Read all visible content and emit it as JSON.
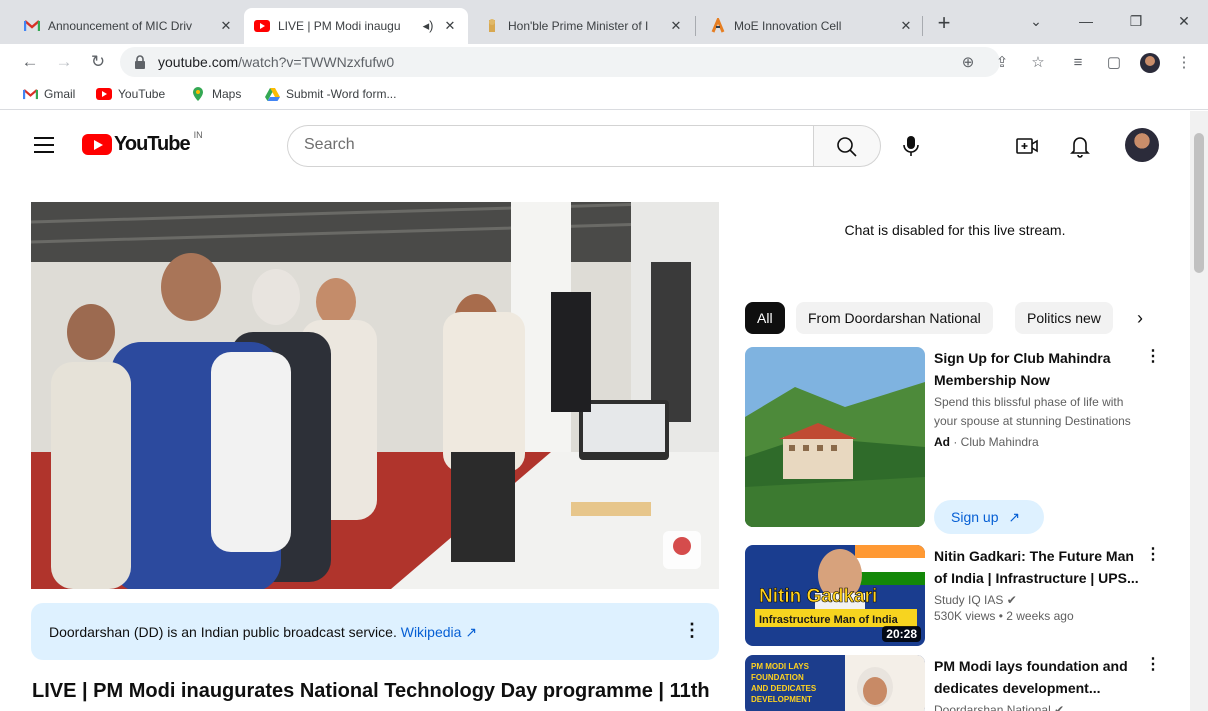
{
  "browser": {
    "tabs": [
      {
        "title": "Announcement of MIC Driv",
        "active": false,
        "favicon": "gmail-icon"
      },
      {
        "title": "LIVE | PM Modi inaugu",
        "active": true,
        "favicon": "youtube-icon",
        "muted": true
      },
      {
        "title": "Hon'ble Prime Minister of I",
        "active": false,
        "favicon": "emblem-icon"
      },
      {
        "title": "MoE Innovation Cell",
        "active": false,
        "favicon": "moe-icon"
      }
    ],
    "url": {
      "host": "youtube.com",
      "path": "/watch?v=TWWNzxfufw0"
    },
    "bookmarks": [
      {
        "label": "Gmail",
        "icon": "gmail-icon"
      },
      {
        "label": "YouTube",
        "icon": "youtube-icon"
      },
      {
        "label": "Maps",
        "icon": "maps-icon"
      },
      {
        "label": "Submit -Word form...",
        "icon": "drive-icon"
      }
    ]
  },
  "youtube": {
    "logo_word": "YouTube",
    "country_code": "IN",
    "search_placeholder": "Search"
  },
  "player": {
    "info_panel": {
      "text": "Doordarshan (DD) is an Indian public broadcast service.",
      "link": "Wikipedia"
    },
    "title": "LIVE | PM Modi inaugurates National Technology Day programme | 11th"
  },
  "sidebar": {
    "chat_message": "Chat is disabled for this live stream.",
    "chips": [
      "All",
      "From Doordarshan National",
      "Politics new"
    ],
    "recommendations": [
      {
        "title_l1": "Sign Up for Club Mahindra",
        "title_l2": "Membership Now",
        "description": "Spend this blissful phase of life with your spouse at stunning Destinations",
        "ad_label": "Ad",
        "channel": "Club Mahindra",
        "cta": "Sign up"
      },
      {
        "title_l1": "Nitin Gadkari: The Future Man",
        "title_l2": "of India | Infrastructure | UPS...",
        "channel": "Study IQ IAS",
        "stats": "530K views • 2 weeks ago",
        "duration": "20:28",
        "thumb_text_1": "Nitin Gadkari",
        "thumb_text_2": "Infrastructure Man of India"
      },
      {
        "title_l1": "PM Modi lays foundation and",
        "title_l2": "dedicates development...",
        "channel": "Doordarshan National",
        "thumb_text": "PM MODI LAYS FOUNDATION AND DEDICATES DEVELOPMENT"
      }
    ]
  },
  "colors": {
    "yt_red": "#ff0000",
    "link_blue": "#065fd4",
    "info_bg": "#def1ff",
    "chip_bg": "#f2f2f2"
  }
}
